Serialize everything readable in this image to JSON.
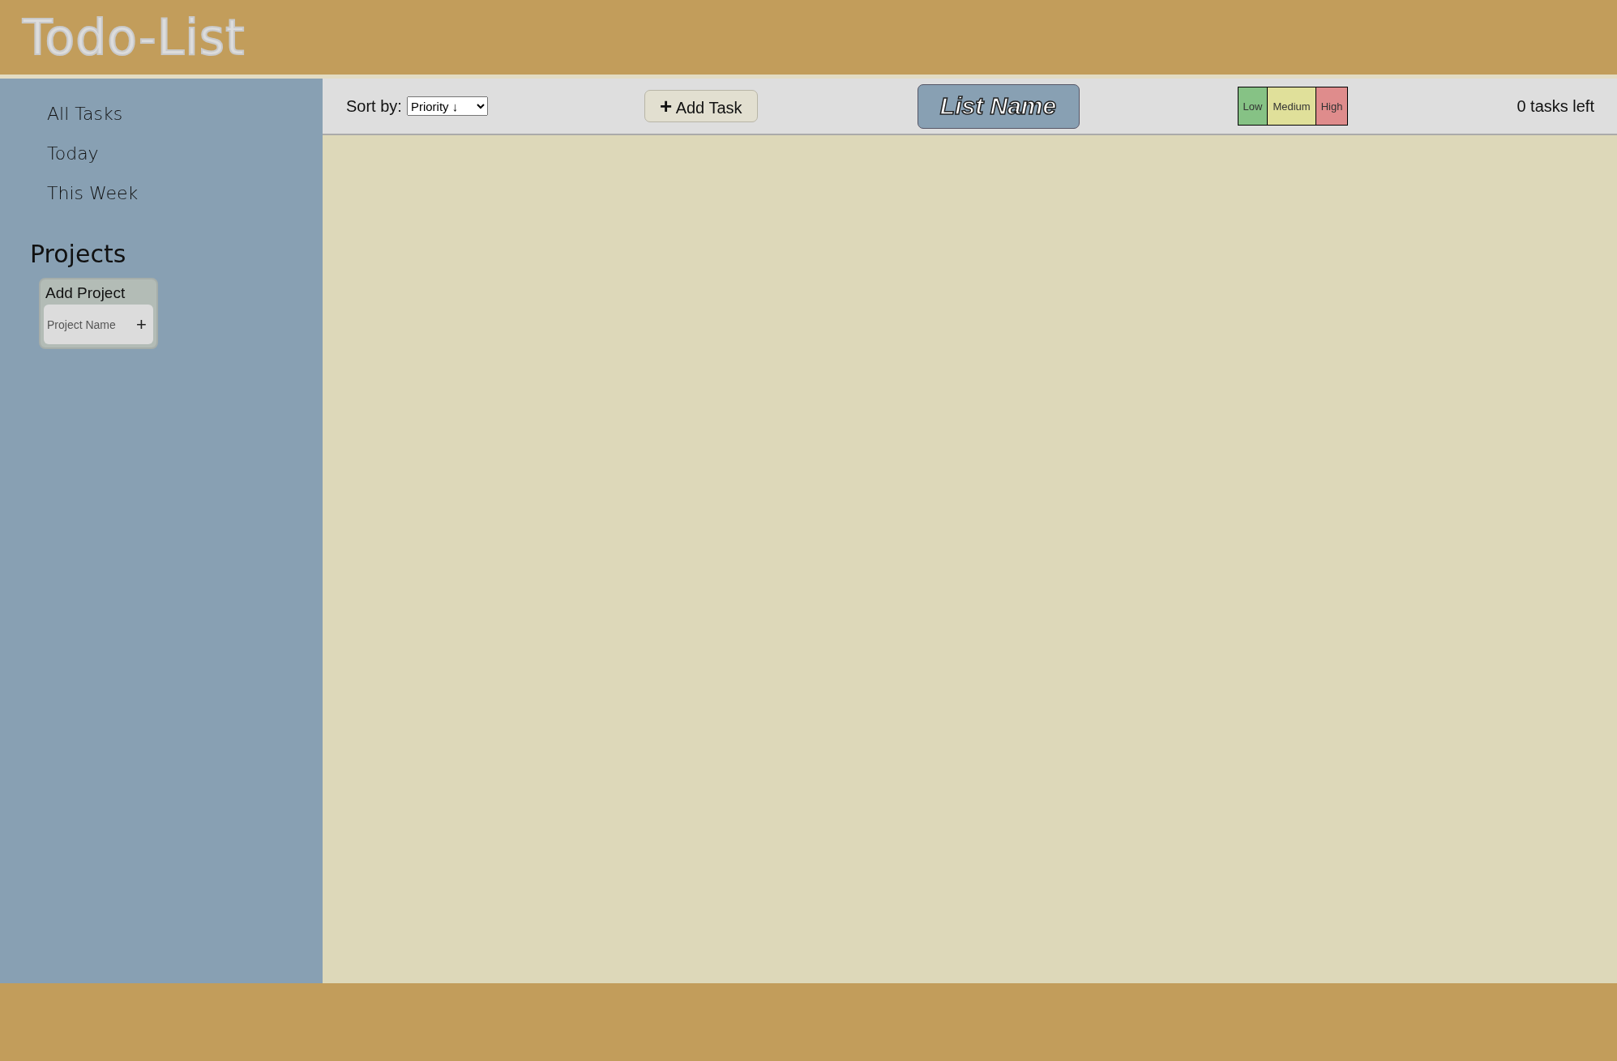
{
  "header": {
    "title": "Todo-List"
  },
  "sidebar": {
    "items": [
      {
        "label": "All Tasks"
      },
      {
        "label": "Today"
      },
      {
        "label": "This Week"
      }
    ],
    "projects_heading": "Projects",
    "add_project": {
      "title": "Add Project",
      "placeholder": "Project Name",
      "button": "+"
    }
  },
  "toolbar": {
    "sort_label": "Sort by:",
    "sort_value": "Priority ↓",
    "add_task": {
      "icon": "+",
      "label": "Add Task"
    },
    "list_name": "List Name",
    "priorities": [
      {
        "label": "Low",
        "color": "#86c285"
      },
      {
        "label": "Medium",
        "color": "#e0e09a"
      },
      {
        "label": "High",
        "color": "#df8c8c"
      }
    ],
    "tasks_left": "0 tasks left"
  }
}
